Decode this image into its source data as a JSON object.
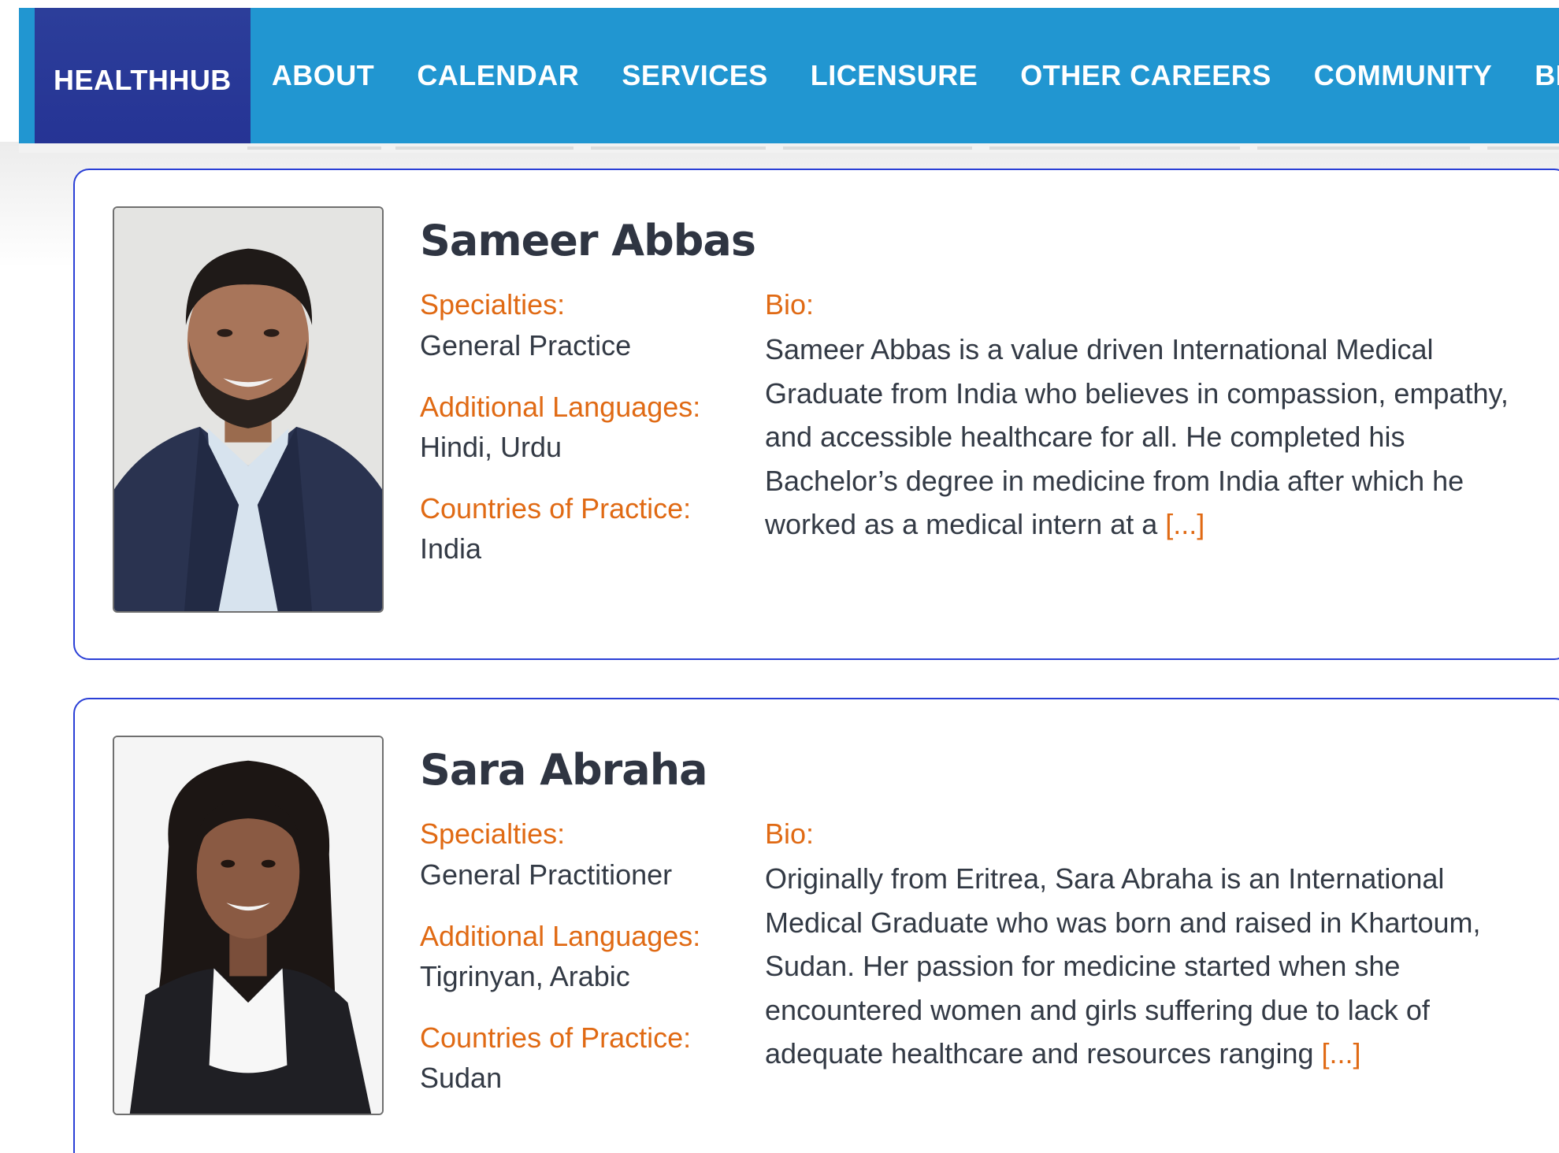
{
  "nav": {
    "items": [
      {
        "label": "HEALTHHUB",
        "active": true
      },
      {
        "label": "ABOUT"
      },
      {
        "label": "CALENDAR"
      },
      {
        "label": "SERVICES"
      },
      {
        "label": "LICENSURE"
      },
      {
        "label": "OTHER CAREERS"
      },
      {
        "label": "COMMUNITY"
      },
      {
        "label": "BLOG"
      }
    ],
    "bg_color": "#2196d1",
    "active_color": "#253394"
  },
  "accent_color": "#e06a14",
  "profiles": [
    {
      "name": "Sameer Abbas",
      "specialties_label": "Specialties:",
      "specialties": "General Practice",
      "languages_label": "Additional Languages:",
      "languages": "Hindi, Urdu",
      "countries_label": "Countries of Practice:",
      "countries": "India",
      "bio_label": "Bio:",
      "bio": "Sameer Abbas is a value driven International Medical Graduate from India who believes in compassion, empathy, and accessible healthcare for all. He completed his Bachelor’s degree in medicine from India after which he worked as a medical intern at a",
      "more": "[...]"
    },
    {
      "name": "Sara Abraha",
      "specialties_label": "Specialties:",
      "specialties": "General Practitioner",
      "languages_label": "Additional Languages:",
      "languages": "Tigrinyan, Arabic",
      "countries_label": "Countries of Practice:",
      "countries": "Sudan",
      "bio_label": "Bio:",
      "bio": "Originally from Eritrea, Sara Abraha is an International Medical Graduate who was born and raised in Khartoum, Sudan. Her passion for medicine started when she encountered women and girls suffering due to lack of adequate healthcare and resources ranging",
      "more": "[...]"
    }
  ]
}
